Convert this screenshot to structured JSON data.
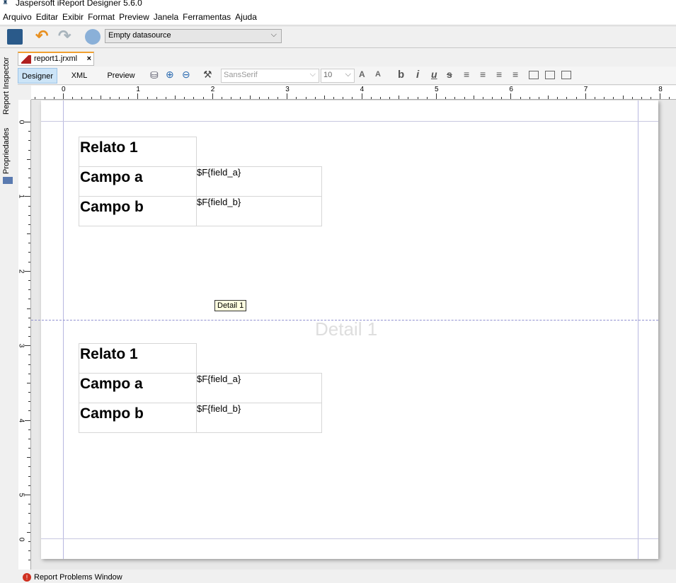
{
  "window": {
    "title": "Jaspersoft iReport Designer 5.6.0"
  },
  "menu": [
    "Arquivo",
    "Editar",
    "Exibir",
    "Format",
    "Preview",
    "Janela",
    "Ferramentas",
    "Ajuda"
  ],
  "toolbar": {
    "datasource": "Empty datasource"
  },
  "side_tabs": [
    "Report Inspector",
    "Propriedades"
  ],
  "document_tab": {
    "label": "report1.jrxml",
    "close": "×"
  },
  "editor_tabs": [
    "Designer",
    "XML",
    "Preview"
  ],
  "font": {
    "family": "SansSerif",
    "size": "10"
  },
  "ruler": {
    "h": [
      "0",
      "1",
      "2",
      "3",
      "4",
      "5",
      "6",
      "7",
      "8"
    ],
    "v": [
      "0",
      "1",
      "2",
      "3",
      "4",
      "5",
      "0"
    ]
  },
  "report": {
    "groups": [
      {
        "title": "Relato 1",
        "rows": [
          {
            "label": "Campo a",
            "field": "$F{field_a}"
          },
          {
            "label": "Campo b",
            "field": "$F{field_b}"
          }
        ]
      },
      {
        "title": "Relato 1",
        "rows": [
          {
            "label": "Campo a",
            "field": "$F{field_a}"
          },
          {
            "label": "Campo b",
            "field": "$F{field_b}"
          }
        ]
      }
    ],
    "band_tooltip": "Detail 1",
    "band_watermark": "Detail 1"
  },
  "status": {
    "problems": "Report Problems Window"
  }
}
